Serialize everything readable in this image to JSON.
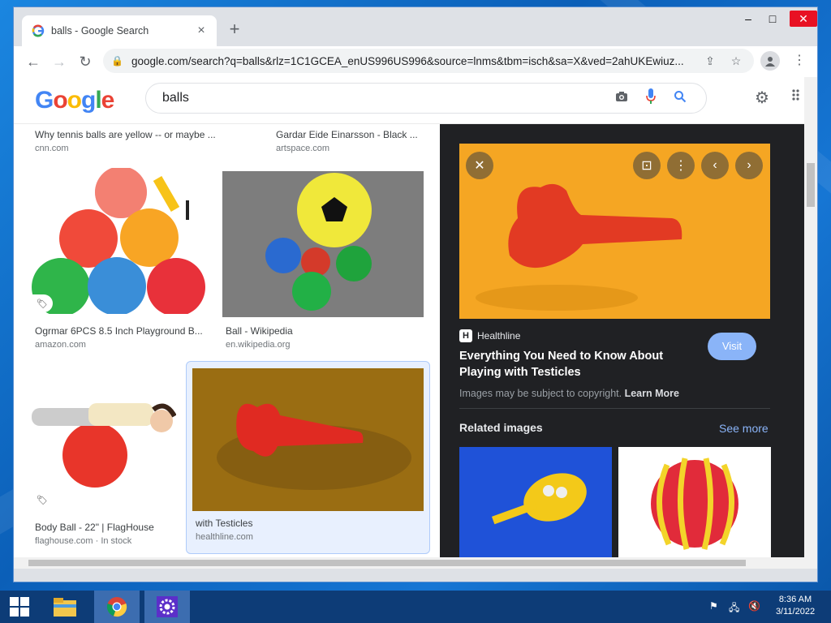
{
  "tab": {
    "title": "balls - Google Search",
    "close": "×",
    "new_tab": "+"
  },
  "window_controls": {
    "minimize": "–",
    "maximize": "□",
    "close": "✕"
  },
  "toolbar": {
    "back": "←",
    "forward": "→",
    "reload": "↻",
    "lock": "🔒",
    "url": "google.com/search?q=balls&rlz=1C1GCEA_enUS996US996&source=lnms&tbm=isch&sa=X&ved=2ahUKEwiuz...",
    "share": "⇪",
    "star": "☆",
    "menu": "⋮"
  },
  "google": {
    "logo": [
      "G",
      "o",
      "o",
      "g",
      "l",
      "e"
    ],
    "logo_colors": [
      "#4285f4",
      "#ea4335",
      "#fbbc05",
      "#4285f4",
      "#34a853",
      "#ea4335"
    ],
    "query": "balls",
    "settings": "⚙",
    "apps": "⋮⋮"
  },
  "results": {
    "row0": [
      {
        "caption": "Why tennis balls are yellow -- or maybe ...",
        "source": "cnn.com"
      },
      {
        "caption": "Gardar Eide Einarsson - Black ...",
        "source": "artspace.com"
      }
    ],
    "row1": [
      {
        "caption": "Ogrmar 6PCS 8.5 Inch Playground B...",
        "source": "amazon.com"
      },
      {
        "caption": "Ball - Wikipedia",
        "source": "en.wikipedia.org"
      }
    ],
    "row2": [
      {
        "caption": "Body Ball - 22\" | FlagHouse",
        "source": "flaghouse.com · In stock"
      },
      {
        "caption": "with Testicles",
        "source": "healthline.com"
      }
    ]
  },
  "panel": {
    "source": "Healthline",
    "source_logo": "H",
    "visit": "Visit",
    "title": "Everything You Need to Know About Playing with Testicles",
    "copyright": "Images may be subject to copyright.",
    "learn_more": "Learn More",
    "related": "Related images",
    "see_more": "See more",
    "buttons": {
      "close": "✕",
      "lens": "⊡",
      "more": "⋮",
      "prev": "‹",
      "next": "›"
    }
  },
  "taskbar": {
    "time": "8:36 AM",
    "date": "3/11/2022"
  },
  "colors": {
    "accent": "#1a73e8",
    "panel_bg": "#202124",
    "taskbar": "#0d3c77"
  }
}
